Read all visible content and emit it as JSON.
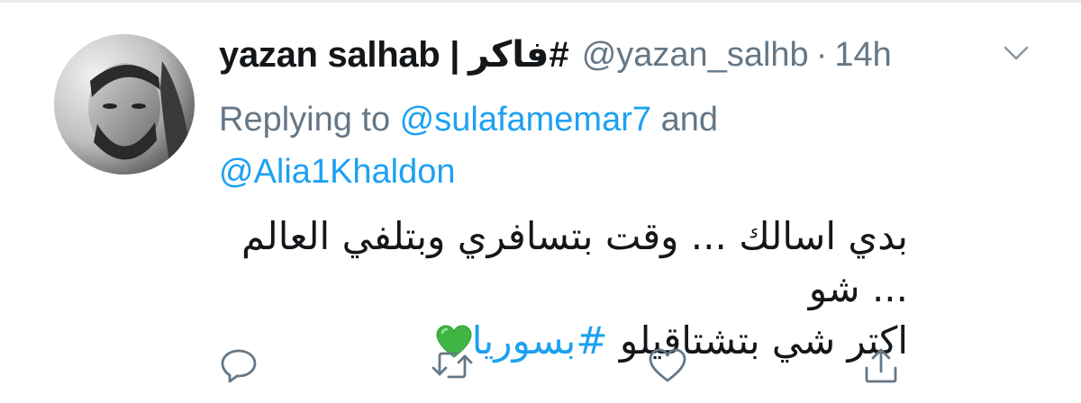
{
  "tweet": {
    "author": {
      "name": "yazan salhab |",
      "name_hashtag": "#فاكر",
      "handle": "@yazan_salhb",
      "separator": "·",
      "time": "14h"
    },
    "reply": {
      "prefix": "Replying to ",
      "mention1": "@sulafamemar7",
      "joiner": " and",
      "mention2": "@Alia1Khaldon"
    },
    "text": {
      "line1": "بدي اسالك ... وقت بتسافري وبتلفي العالم ... شو",
      "line2_text": "اكتر شي بتشتاقيلو ",
      "line2_hashtag": "#بسوريا",
      "emoji": "green-heart-emoji"
    },
    "actions": [
      "reply-icon",
      "retweet-icon",
      "like-icon",
      "share-icon"
    ],
    "colors": {
      "text": "#14171a",
      "secondary": "#657786",
      "link": "#1da1f2",
      "heart": "#3fb544"
    }
  }
}
